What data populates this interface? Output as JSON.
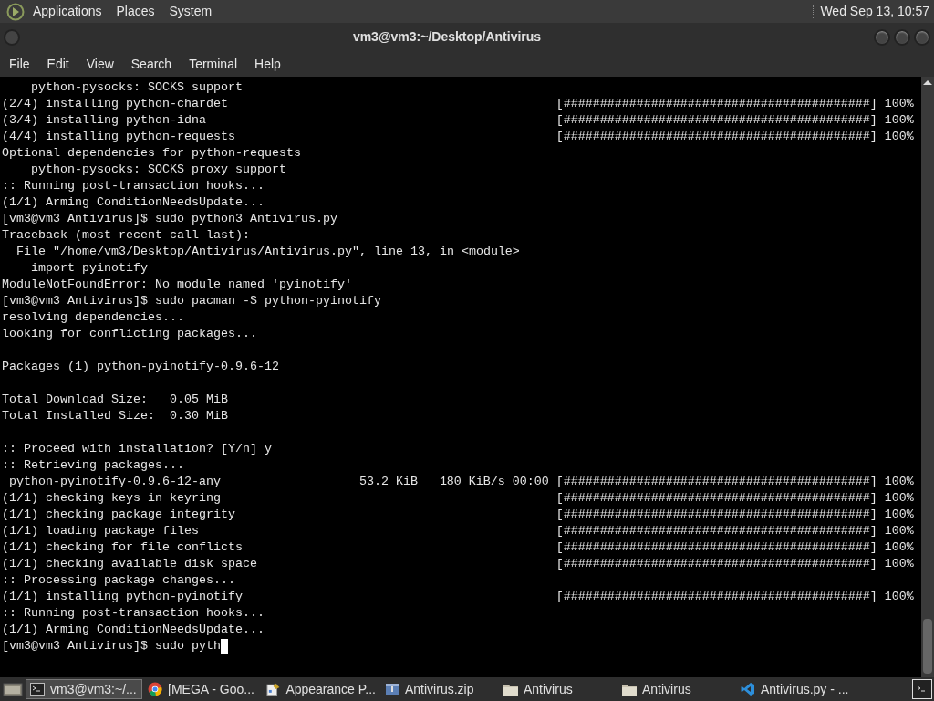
{
  "top_panel": {
    "menus": [
      "Applications",
      "Places",
      "System"
    ],
    "clock": "Wed Sep 13, 10:57"
  },
  "window": {
    "title": "vm3@vm3:~/Desktop/Antivirus"
  },
  "menu_bar": [
    "File",
    "Edit",
    "View",
    "Search",
    "Terminal",
    "Help"
  ],
  "terminal": {
    "lines": [
      {
        "kind": "text",
        "text": "    python-pysocks: SOCKS support"
      },
      {
        "kind": "progress",
        "text": "(2/4) installing python-chardet",
        "bar": "[##########################################]",
        "percent": "100%"
      },
      {
        "kind": "progress",
        "text": "(3/4) installing python-idna",
        "bar": "[##########################################]",
        "percent": "100%"
      },
      {
        "kind": "progress",
        "text": "(4/4) installing python-requests",
        "bar": "[##########################################]",
        "percent": "100%"
      },
      {
        "kind": "text",
        "text": "Optional dependencies for python-requests"
      },
      {
        "kind": "text",
        "text": "    python-pysocks: SOCKS proxy support"
      },
      {
        "kind": "text",
        "text": ":: Running post-transaction hooks..."
      },
      {
        "kind": "text",
        "text": "(1/1) Arming ConditionNeedsUpdate..."
      },
      {
        "kind": "text",
        "text": "[vm3@vm3 Antivirus]$ sudo python3 Antivirus.py"
      },
      {
        "kind": "text",
        "text": "Traceback (most recent call last):"
      },
      {
        "kind": "text",
        "text": "  File \"/home/vm3/Desktop/Antivirus/Antivirus.py\", line 13, in <module>"
      },
      {
        "kind": "text",
        "text": "    import pyinotify"
      },
      {
        "kind": "text",
        "text": "ModuleNotFoundError: No module named 'pyinotify'"
      },
      {
        "kind": "text",
        "text": "[vm3@vm3 Antivirus]$ sudo pacman -S python-pyinotify"
      },
      {
        "kind": "text",
        "text": "resolving dependencies..."
      },
      {
        "kind": "text",
        "text": "looking for conflicting packages..."
      },
      {
        "kind": "blank"
      },
      {
        "kind": "text",
        "text": "Packages (1) python-pyinotify-0.9.6-12"
      },
      {
        "kind": "blank"
      },
      {
        "kind": "text",
        "text": "Total Download Size:   0.05 MiB"
      },
      {
        "kind": "text",
        "text": "Total Installed Size:  0.30 MiB"
      },
      {
        "kind": "blank"
      },
      {
        "kind": "text",
        "text": ":: Proceed with installation? [Y/n] y"
      },
      {
        "kind": "text",
        "text": ":: Retrieving packages..."
      },
      {
        "kind": "download",
        "text": " python-pyinotify-0.9.6-12-any",
        "size": "53.2 KiB",
        "rate": "180 KiB/s 00:00",
        "bar": "[##########################################]",
        "percent": "100%"
      },
      {
        "kind": "progress",
        "text": "(1/1) checking keys in keyring",
        "bar": "[##########################################]",
        "percent": "100%"
      },
      {
        "kind": "progress",
        "text": "(1/1) checking package integrity",
        "bar": "[##########################################]",
        "percent": "100%"
      },
      {
        "kind": "progress",
        "text": "(1/1) loading package files",
        "bar": "[##########################################]",
        "percent": "100%"
      },
      {
        "kind": "progress",
        "text": "(1/1) checking for file conflicts",
        "bar": "[##########################################]",
        "percent": "100%"
      },
      {
        "kind": "progress",
        "text": "(1/1) checking available disk space",
        "bar": "[##########################################]",
        "percent": "100%"
      },
      {
        "kind": "text",
        "text": ":: Processing package changes..."
      },
      {
        "kind": "progress",
        "text": "(1/1) installing python-pyinotify",
        "bar": "[##########################################]",
        "percent": "100%"
      },
      {
        "kind": "text",
        "text": ":: Running post-transaction hooks..."
      },
      {
        "kind": "text",
        "text": "(1/1) Arming ConditionNeedsUpdate..."
      },
      {
        "kind": "prompt",
        "text": "[vm3@vm3 Antivirus]$ sudo pyth",
        "cursor": true
      }
    ]
  },
  "taskbar": {
    "items": [
      {
        "kind": "terminal",
        "label": "vm3@vm3:~/...",
        "selected": true
      },
      {
        "kind": "browser",
        "label": "[MEGA - Goo...",
        "selected": false
      },
      {
        "kind": "appearance",
        "label": "Appearance P...",
        "selected": false
      },
      {
        "kind": "archive",
        "label": "Antivirus.zip",
        "selected": false
      },
      {
        "kind": "folder",
        "label": "Antivirus",
        "selected": false
      },
      {
        "kind": "folder",
        "label": "Antivirus",
        "selected": false
      },
      {
        "kind": "code",
        "label": "Antivirus.py - ...",
        "selected": false
      }
    ]
  }
}
